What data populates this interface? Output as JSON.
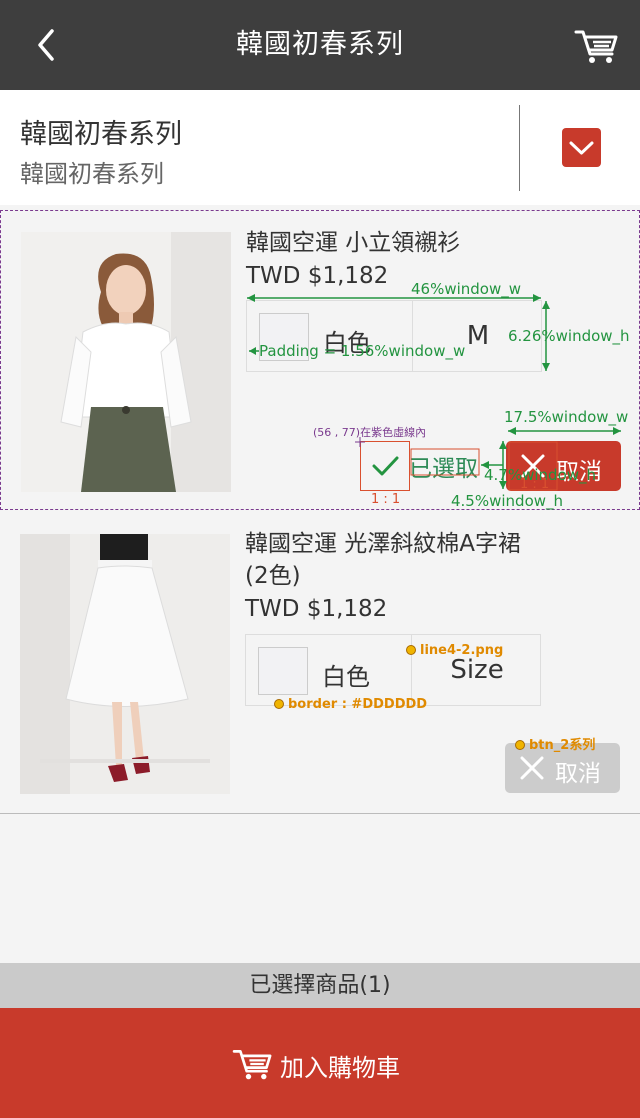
{
  "header": {
    "title": "韓國初春系列",
    "back_icon": "chevron-left-icon",
    "cart_icon": "cart-icon"
  },
  "category": {
    "title": "韓國初春系列",
    "subtitle": "韓國初春系列",
    "dropdown_icon": "chevron-down-icon"
  },
  "products": [
    {
      "name": "韓國空運 小立領襯衫",
      "price": "TWD $1,182",
      "color": "白色",
      "size": "M",
      "selected_label": "已選取",
      "cancel_label": "取消"
    },
    {
      "name_line1": "韓國空運 光澤斜紋棉A字裙",
      "name_line2": " (2色)",
      "price": "TWD $1,182",
      "color": "白色",
      "size": "Size",
      "cancel_label": "取消"
    }
  ],
  "annotations": {
    "w46": "46%window_w",
    "h626": "6.26%window_h",
    "padding": "Padding = 1.56%window_w",
    "w175": "17.5%window_w",
    "coord": "(56 , 77)在紫色虛線內",
    "h47": "4.7%window_h",
    "h45": "4.5%window_h",
    "ratio1": "1 : 1",
    "ratio2": "1 : 1",
    "tag_line": "line4-2.png",
    "tag_border": "border : #DDDDDD",
    "tag_btn": "btn_2系列"
  },
  "footer": {
    "selected_count": "已選擇商品(1)",
    "add_to_cart": "加入購物車"
  },
  "colors": {
    "topbar": "#3e3e3e",
    "accent_red": "#c83a2b",
    "disabled": "#cccccc",
    "border": "#DDDDDD"
  }
}
